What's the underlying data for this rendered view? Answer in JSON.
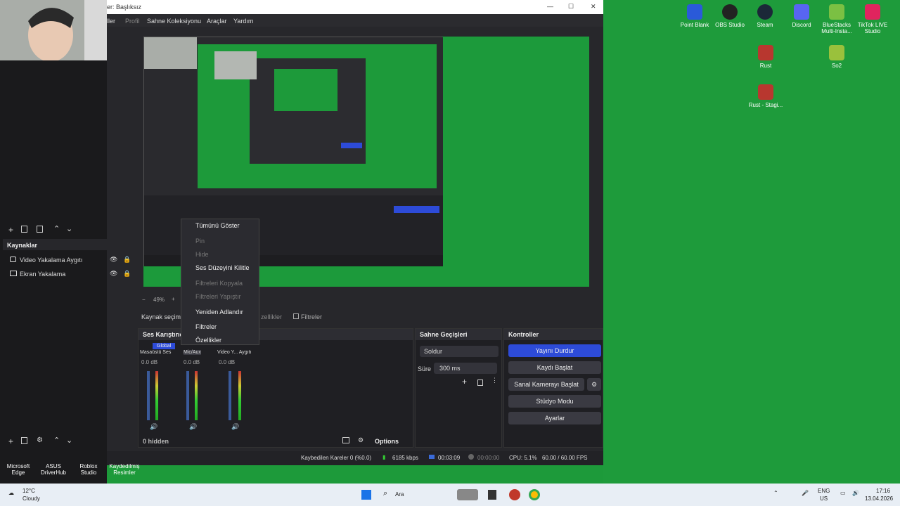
{
  "window": {
    "title": "er: Başlıksız",
    "min": "—",
    "max": "☐",
    "close": "✕"
  },
  "menu": {
    "items": [
      "ller",
      "Profil",
      "Sahne Koleksiyonu",
      "Araçlar",
      "Yardım"
    ]
  },
  "preview": {
    "zoom": "49%",
    "minus": "−",
    "plus": "+"
  },
  "sources": {
    "title": "Kaynaklar",
    "items": [
      {
        "label": "Video Yakalama Aygıtı"
      },
      {
        "label": "Ekran Yakalama"
      }
    ]
  },
  "source_toolbar": {
    "selected": "Kaynak seçim",
    "props": "zellikler",
    "filters": "Filtreler"
  },
  "context_menu": {
    "items": [
      {
        "label": "Tümünü Göster",
        "disabled": false
      },
      {
        "label": "Pin",
        "disabled": true
      },
      {
        "label": "Hide",
        "disabled": true
      },
      {
        "label": "Ses Düzeyini Kilitle",
        "disabled": false
      },
      {
        "label": "Filtreleri Kopyala",
        "disabled": true
      },
      {
        "label": "Filtreleri Yapıştır",
        "disabled": true
      },
      {
        "label": "Yeniden Adlandır",
        "disabled": false
      },
      {
        "label": "Filtreler",
        "disabled": false
      },
      {
        "label": "Özellikler",
        "disabled": false
      }
    ]
  },
  "mixer": {
    "title": "Ses Karıştırıc",
    "global": "Global",
    "channels": [
      {
        "name": "Masaüstü Ses",
        "db": "0.0 dB"
      },
      {
        "name": "Mic/Aux",
        "db": "0.0 dB"
      },
      {
        "name": "Video Y... Aygıtı",
        "db": "0.0 dB"
      }
    ],
    "hidden": "0 hidden",
    "options": "Options"
  },
  "transitions": {
    "title": "Sahne Geçişleri",
    "type": "Soldur",
    "duration_label": "Süre",
    "duration": "300 ms"
  },
  "controls": {
    "title": "Kontroller",
    "buttons": [
      "Yayını Durdur",
      "Kaydı Başlat",
      "Sanal Kamerayı Başlat",
      "Stüdyo Modu",
      "Ayarlar"
    ]
  },
  "status": {
    "dropped": "Kaybedilen Kareler 0 (%0.0)",
    "bitrate": "6185 kbps",
    "stream_time": "00:03:09",
    "rec_time": "00:00:00",
    "cpu": "CPU: 5.1%",
    "fps": "60.00 / 60.00 FPS"
  },
  "desktop_icons": [
    {
      "label": "Point Blank"
    },
    {
      "label": "OBS Studio"
    },
    {
      "label": "Steam"
    },
    {
      "label": "Discord"
    },
    {
      "label": "BlueStacks Multi-Insta..."
    },
    {
      "label": "TikTok LIVE Studio"
    },
    {
      "label": "Rust"
    },
    {
      "label": "So2"
    },
    {
      "label": "Rust - Stagi..."
    }
  ],
  "left_desktop_icons": [
    {
      "label": "Microsoft Edge"
    },
    {
      "label": "ASUS DriverHub"
    },
    {
      "label": "Roblox Studio"
    },
    {
      "label": "Kaydedilmiş Resimler"
    }
  ],
  "taskbar": {
    "weather_temp": "12°C",
    "weather_desc": "Cloudy",
    "search": "Ara",
    "lang1": "ENG",
    "lang2": "US",
    "time": "17:16",
    "date": "13.04.2026"
  },
  "colors": {
    "accent": "#2d4bd8",
    "desktop": "#1e9b3b",
    "obs_bg": "#27272b"
  }
}
